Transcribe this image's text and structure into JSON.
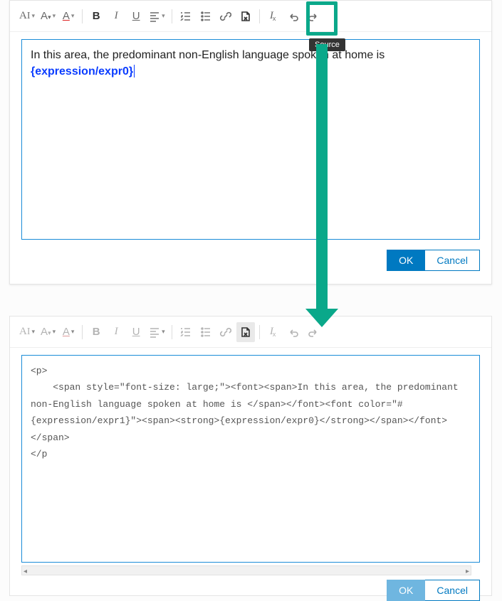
{
  "tooltip": {
    "source": "Source"
  },
  "top": {
    "content_prefix": "In this area, the predominant non-English language spoken at home is ",
    "content_expr": "{expression/expr0}",
    "ok": "OK",
    "cancel": "Cancel"
  },
  "bottom": {
    "source_code": "<p>\n    <span style=\"font-size: large;\"><font><span>In this area, the predominant non-English language spoken at home is </span></font><font color=\"#{expression/expr1}\"><span><strong>{expression/expr0}</strong></span></font></span>\n</p",
    "ok": "OK",
    "cancel": "Cancel"
  },
  "toolbar_labels": {
    "font": "A",
    "size": "A",
    "color": "A",
    "bold": "B",
    "italic": "I",
    "underline": "U",
    "clear": "x"
  }
}
